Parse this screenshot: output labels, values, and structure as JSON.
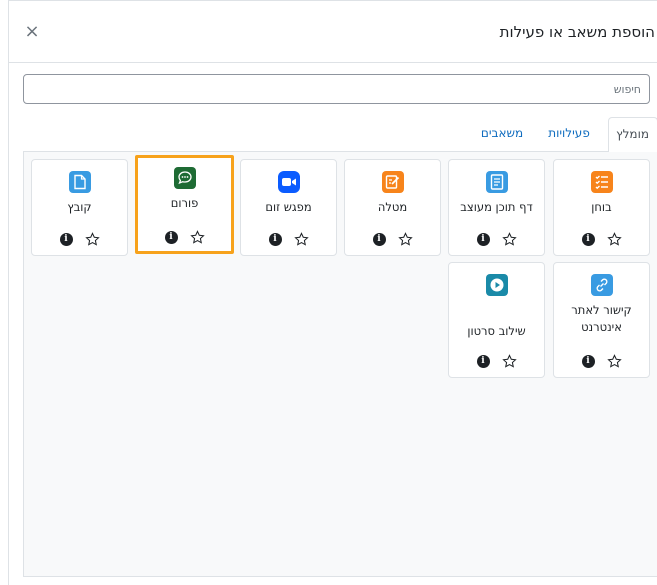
{
  "modal": {
    "title": "הוספת משאב או פעילות",
    "close_glyph": "×"
  },
  "search": {
    "placeholder": "חיפוש",
    "value": ""
  },
  "tabs": [
    {
      "label": "מומלץ",
      "active": true
    },
    {
      "label": "פעילויות",
      "active": false
    },
    {
      "label": "משאבים",
      "active": false
    }
  ],
  "modules": [
    {
      "label": "בוחן",
      "icon": "quiz-icon",
      "color": "#f7841b"
    },
    {
      "label": "דף תוכן מעוצב",
      "icon": "page-icon",
      "color": "#399be2"
    },
    {
      "label": "מטלה",
      "icon": "assignment-icon",
      "color": "#f7841b"
    },
    {
      "label": "מפגש זום",
      "icon": "zoom-camera-icon",
      "color": "#0b5cff"
    },
    {
      "label": "פורום",
      "icon": "forum-chat-icon",
      "color": "#2b7a3e",
      "selected": true
    },
    {
      "label": "קובץ",
      "icon": "file-icon",
      "color": "#399be2"
    },
    {
      "label": "קישור לאתר אינטרנט",
      "icon": "link-icon",
      "color": "#399be2"
    },
    {
      "label": "שילוב סרטון",
      "icon": "video-play-icon",
      "color": "#1a8aa8"
    }
  ],
  "actions": {
    "info_glyph": "i",
    "star_icon": "star-icon"
  }
}
